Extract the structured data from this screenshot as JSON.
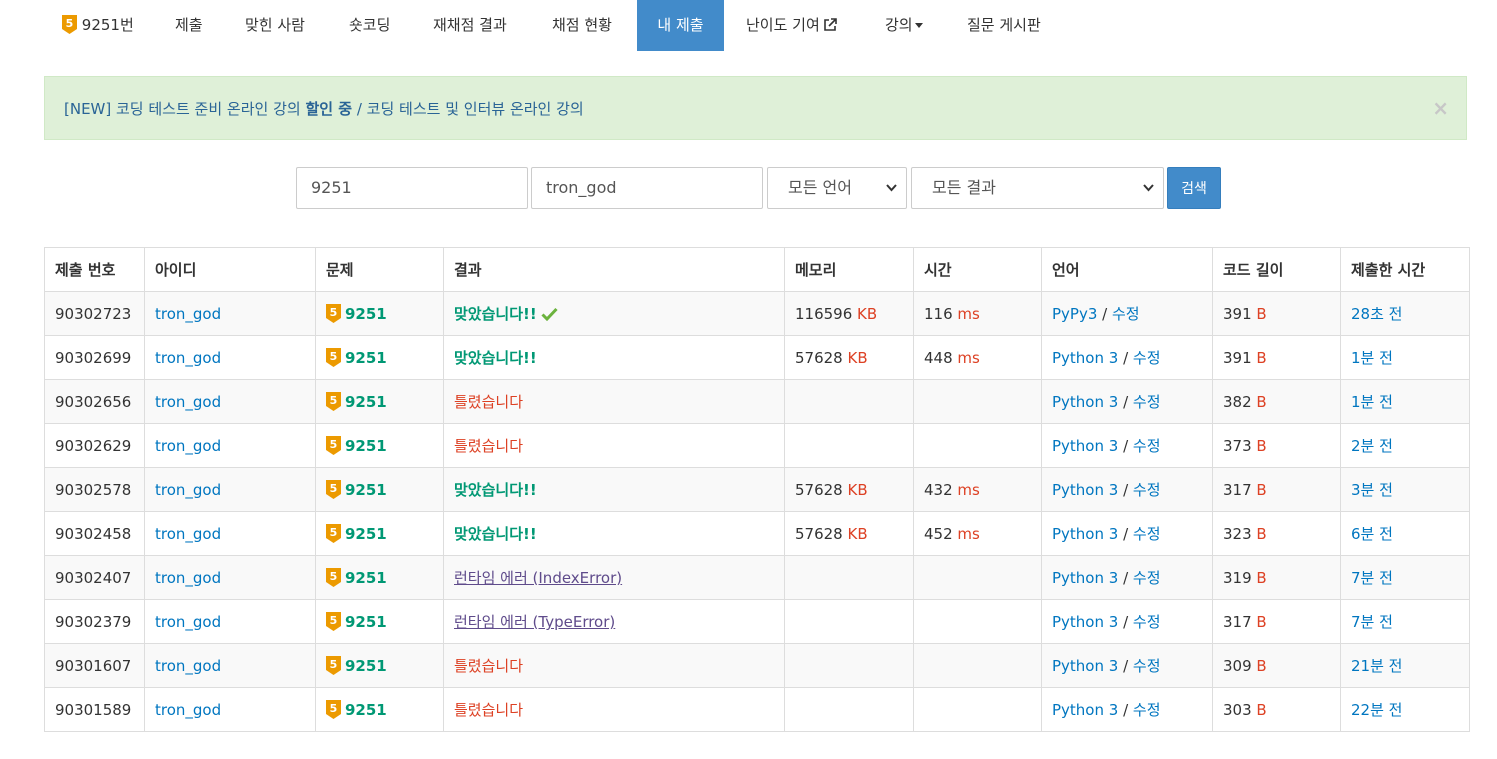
{
  "nav": {
    "problem_label": "9251번",
    "tier": "5",
    "items": [
      "제출",
      "맞힌 사람",
      "숏코딩",
      "재채점 결과",
      "채점 현황",
      "내 제출",
      "난이도 기여",
      "강의",
      "질문 게시판"
    ]
  },
  "alert": {
    "prefix": "[NEW] 코딩 테스트 준비 온라인 강의 ",
    "bold": "할인 중",
    "suffix": " / 코딩 테스트 및 인터뷰 온라인 강의",
    "close": "×"
  },
  "search": {
    "problem_id": "9251",
    "user_id": "tron_god",
    "language": "모든 언어",
    "result": "모든 결과",
    "button": "검색"
  },
  "table": {
    "headers": [
      "제출 번호",
      "아이디",
      "문제",
      "결과",
      "메모리",
      "시간",
      "언어",
      "코드 길이",
      "제출한 시간"
    ],
    "memory_unit": "KB",
    "time_unit": "ms",
    "length_unit": "B",
    "edit_label": "수정",
    "rows": [
      {
        "id": "90302723",
        "user": "tron_god",
        "problem": "9251",
        "result": "맞았습니다!!",
        "memory": "116596",
        "time": "116",
        "lang": "PyPy3",
        "length": "391",
        "when": "28초 전"
      },
      {
        "id": "90302699",
        "user": "tron_god",
        "problem": "9251",
        "result": "맞았습니다!!",
        "memory": "57628",
        "time": "448",
        "lang": "Python 3",
        "length": "391",
        "when": "1분 전"
      },
      {
        "id": "90302656",
        "user": "tron_god",
        "problem": "9251",
        "result": "틀렸습니다",
        "memory": "",
        "time": "",
        "lang": "Python 3",
        "length": "382",
        "when": "1분 전"
      },
      {
        "id": "90302629",
        "user": "tron_god",
        "problem": "9251",
        "result": "틀렸습니다",
        "memory": "",
        "time": "",
        "lang": "Python 3",
        "length": "373",
        "when": "2분 전"
      },
      {
        "id": "90302578",
        "user": "tron_god",
        "problem": "9251",
        "result": "맞았습니다!!",
        "memory": "57628",
        "time": "432",
        "lang": "Python 3",
        "length": "317",
        "when": "3분 전"
      },
      {
        "id": "90302458",
        "user": "tron_god",
        "problem": "9251",
        "result": "맞았습니다!!",
        "memory": "57628",
        "time": "452",
        "lang": "Python 3",
        "length": "323",
        "when": "6분 전"
      },
      {
        "id": "90302407",
        "user": "tron_god",
        "problem": "9251",
        "result": "런타임 에러 (IndexError)",
        "memory": "",
        "time": "",
        "lang": "Python 3",
        "length": "319",
        "when": "7분 전"
      },
      {
        "id": "90302379",
        "user": "tron_god",
        "problem": "9251",
        "result": "런타임 에러 (TypeError)",
        "memory": "",
        "time": "",
        "lang": "Python 3",
        "length": "317",
        "when": "7분 전"
      },
      {
        "id": "90301607",
        "user": "tron_god",
        "problem": "9251",
        "result": "틀렸습니다",
        "memory": "",
        "time": "",
        "lang": "Python 3",
        "length": "309",
        "when": "21분 전"
      },
      {
        "id": "90301589",
        "user": "tron_god",
        "problem": "9251",
        "result": "틀렸습니다",
        "memory": "",
        "time": "",
        "lang": "Python 3",
        "length": "303",
        "when": "22분 전"
      }
    ]
  },
  "colors": {
    "accent": "#428bca",
    "link": "#0076c0",
    "accepted": "#009874",
    "wrong": "#dd4124",
    "runtime_error": "#5f4b8b",
    "tier_gold": "#ec9a00"
  }
}
